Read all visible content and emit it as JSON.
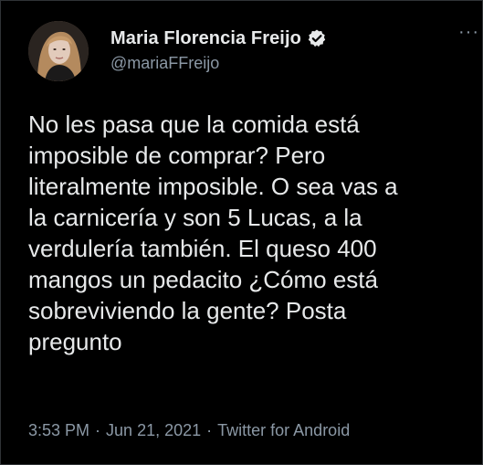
{
  "tweet": {
    "display_name": "Maria Florencia Freijo",
    "handle": "@mariaFFreijo",
    "verified": true,
    "text": "No les pasa que la comida está\nimposible de comprar? Pero\nliteralmente imposible. O sea vas a\nla carnicería y son 5 Lucas, a la\nverdulería también. El queso 400\nmangos un pedacito ¿Cómo está\nsobreviviendo la gente? Posta\npregunto",
    "time": "3:53 PM",
    "date": "Jun 21, 2021",
    "source": "Twitter for Android",
    "separator": "·",
    "more_label": "···"
  },
  "icons": {
    "avatar": "profile-photo",
    "verified": "verified-badge-icon",
    "more": "more-options-icon"
  },
  "colors": {
    "background": "#000000",
    "text_primary": "#e7e9ea",
    "text_secondary": "#8b98a5",
    "border": "#2f3336"
  }
}
